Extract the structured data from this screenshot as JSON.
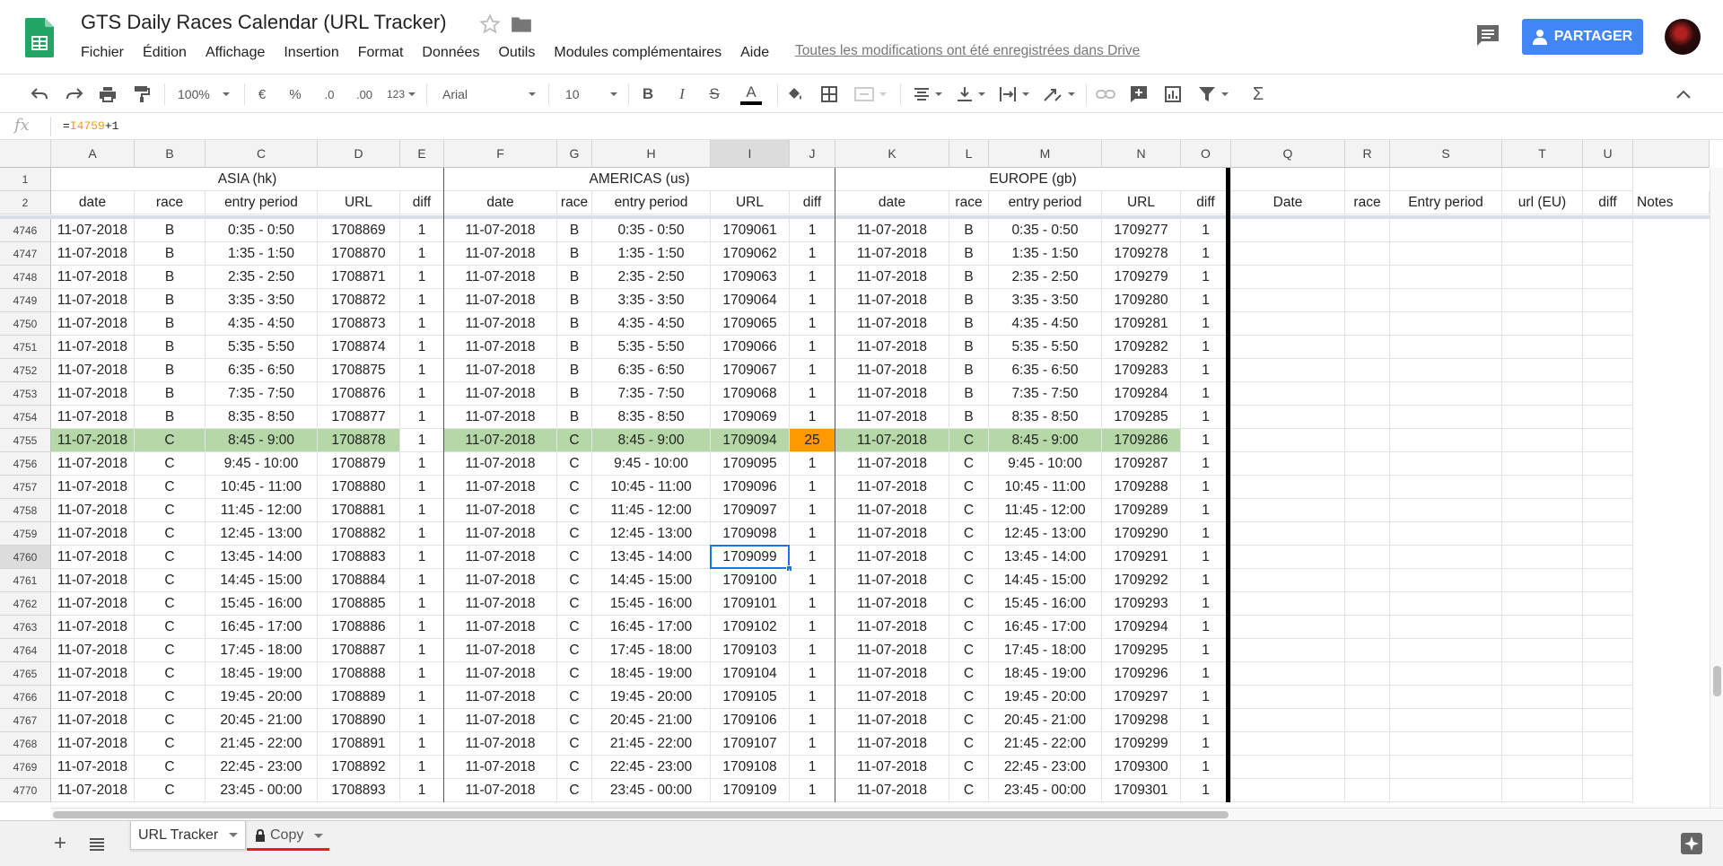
{
  "header": {
    "title": "GTS Daily Races Calendar (URL Tracker)",
    "menu": [
      "Fichier",
      "Édition",
      "Affichage",
      "Insertion",
      "Format",
      "Données",
      "Outils",
      "Modules complémentaires",
      "Aide"
    ],
    "saved_status": "Toutes les modifications ont été enregistrées dans Drive",
    "share_label": "PARTAGER"
  },
  "toolbar": {
    "zoom": "100%",
    "currency": "€",
    "percent": "%",
    "dec_less": ".0",
    "dec_more": ".00",
    "more_formats": "123",
    "font": "Arial",
    "font_size": "10",
    "bold": "B",
    "italic": "I",
    "strike": "S",
    "text_color_label": "A",
    "sum": "Σ"
  },
  "formula_bar": {
    "fx": "fx",
    "prefix": "=",
    "ref": "I4759",
    "suffix": "+1"
  },
  "colors": {
    "green_row": "#b6d7a8",
    "orange_cell": "#ff9900",
    "selection": "#1a73e8",
    "share": "#4285f4"
  },
  "columns": [
    "A",
    "B",
    "C",
    "D",
    "E",
    "F",
    "G",
    "H",
    "I",
    "J",
    "K",
    "L",
    "M",
    "N",
    "O",
    "Q",
    "R",
    "S",
    "T",
    "U"
  ],
  "active_column": "I",
  "active_row": "4760",
  "frozen_rows": {
    "row1_label": "1",
    "row2_label": "2",
    "groups": [
      "ASIA (hk)",
      "AMERICAS (us)",
      "EUROPE (gb)"
    ],
    "headers_main": [
      "date",
      "race",
      "entry period",
      "URL",
      "diff"
    ],
    "headers_extra": [
      "Date",
      "race",
      "Entry period",
      "url (EU)",
      "diff",
      "Notes"
    ]
  },
  "rows": [
    {
      "n": "4746",
      "date": "11-07-2018",
      "race": "B",
      "period": "0:35 - 0:50",
      "url_asia": "1708869",
      "diff_asia": "1",
      "url_am": "1709061",
      "diff_am": "1",
      "url_eu": "1709277",
      "diff_eu": "1"
    },
    {
      "n": "4747",
      "date": "11-07-2018",
      "race": "B",
      "period": "1:35 - 1:50",
      "url_asia": "1708870",
      "diff_asia": "1",
      "url_am": "1709062",
      "diff_am": "1",
      "url_eu": "1709278",
      "diff_eu": "1"
    },
    {
      "n": "4748",
      "date": "11-07-2018",
      "race": "B",
      "period": "2:35 - 2:50",
      "url_asia": "1708871",
      "diff_asia": "1",
      "url_am": "1709063",
      "diff_am": "1",
      "url_eu": "1709279",
      "diff_eu": "1"
    },
    {
      "n": "4749",
      "date": "11-07-2018",
      "race": "B",
      "period": "3:35 - 3:50",
      "url_asia": "1708872",
      "diff_asia": "1",
      "url_am": "1709064",
      "diff_am": "1",
      "url_eu": "1709280",
      "diff_eu": "1"
    },
    {
      "n": "4750",
      "date": "11-07-2018",
      "race": "B",
      "period": "4:35 - 4:50",
      "url_asia": "1708873",
      "diff_asia": "1",
      "url_am": "1709065",
      "diff_am": "1",
      "url_eu": "1709281",
      "diff_eu": "1"
    },
    {
      "n": "4751",
      "date": "11-07-2018",
      "race": "B",
      "period": "5:35 - 5:50",
      "url_asia": "1708874",
      "diff_asia": "1",
      "url_am": "1709066",
      "diff_am": "1",
      "url_eu": "1709282",
      "diff_eu": "1"
    },
    {
      "n": "4752",
      "date": "11-07-2018",
      "race": "B",
      "period": "6:35 - 6:50",
      "url_asia": "1708875",
      "diff_asia": "1",
      "url_am": "1709067",
      "diff_am": "1",
      "url_eu": "1709283",
      "diff_eu": "1"
    },
    {
      "n": "4753",
      "date": "11-07-2018",
      "race": "B",
      "period": "7:35 - 7:50",
      "url_asia": "1708876",
      "diff_asia": "1",
      "url_am": "1709068",
      "diff_am": "1",
      "url_eu": "1709284",
      "diff_eu": "1"
    },
    {
      "n": "4754",
      "date": "11-07-2018",
      "race": "B",
      "period": "8:35 - 8:50",
      "url_asia": "1708877",
      "diff_asia": "1",
      "url_am": "1709069",
      "diff_am": "1",
      "url_eu": "1709285",
      "diff_eu": "1"
    },
    {
      "n": "4755",
      "date": "11-07-2018",
      "race": "C",
      "period": "8:45 - 9:00",
      "url_asia": "1708878",
      "diff_asia": "1",
      "url_am": "1709094",
      "diff_am": "25",
      "url_eu": "1709286",
      "diff_eu": "1",
      "highlight": true
    },
    {
      "n": "4756",
      "date": "11-07-2018",
      "race": "C",
      "period": "9:45 - 10:00",
      "url_asia": "1708879",
      "diff_asia": "1",
      "url_am": "1709095",
      "diff_am": "1",
      "url_eu": "1709287",
      "diff_eu": "1"
    },
    {
      "n": "4757",
      "date": "11-07-2018",
      "race": "C",
      "period": "10:45 - 11:00",
      "url_asia": "1708880",
      "diff_asia": "1",
      "url_am": "1709096",
      "diff_am": "1",
      "url_eu": "1709288",
      "diff_eu": "1"
    },
    {
      "n": "4758",
      "date": "11-07-2018",
      "race": "C",
      "period": "11:45 - 12:00",
      "url_asia": "1708881",
      "diff_asia": "1",
      "url_am": "1709097",
      "diff_am": "1",
      "url_eu": "1709289",
      "diff_eu": "1"
    },
    {
      "n": "4759",
      "date": "11-07-2018",
      "race": "C",
      "period": "12:45 - 13:00",
      "url_asia": "1708882",
      "diff_asia": "1",
      "url_am": "1709098",
      "diff_am": "1",
      "url_eu": "1709290",
      "diff_eu": "1"
    },
    {
      "n": "4760",
      "date": "11-07-2018",
      "race": "C",
      "period": "13:45 - 14:00",
      "url_asia": "1708883",
      "diff_asia": "1",
      "url_am": "1709099",
      "diff_am": "1",
      "url_eu": "1709291",
      "diff_eu": "1"
    },
    {
      "n": "4761",
      "date": "11-07-2018",
      "race": "C",
      "period": "14:45 - 15:00",
      "url_asia": "1708884",
      "diff_asia": "1",
      "url_am": "1709100",
      "diff_am": "1",
      "url_eu": "1709292",
      "diff_eu": "1"
    },
    {
      "n": "4762",
      "date": "11-07-2018",
      "race": "C",
      "period": "15:45 - 16:00",
      "url_asia": "1708885",
      "diff_asia": "1",
      "url_am": "1709101",
      "diff_am": "1",
      "url_eu": "1709293",
      "diff_eu": "1"
    },
    {
      "n": "4763",
      "date": "11-07-2018",
      "race": "C",
      "period": "16:45 - 17:00",
      "url_asia": "1708886",
      "diff_asia": "1",
      "url_am": "1709102",
      "diff_am": "1",
      "url_eu": "1709294",
      "diff_eu": "1"
    },
    {
      "n": "4764",
      "date": "11-07-2018",
      "race": "C",
      "period": "17:45 - 18:00",
      "url_asia": "1708887",
      "diff_asia": "1",
      "url_am": "1709103",
      "diff_am": "1",
      "url_eu": "1709295",
      "diff_eu": "1"
    },
    {
      "n": "4765",
      "date": "11-07-2018",
      "race": "C",
      "period": "18:45 - 19:00",
      "url_asia": "1708888",
      "diff_asia": "1",
      "url_am": "1709104",
      "diff_am": "1",
      "url_eu": "1709296",
      "diff_eu": "1"
    },
    {
      "n": "4766",
      "date": "11-07-2018",
      "race": "C",
      "period": "19:45 - 20:00",
      "url_asia": "1708889",
      "diff_asia": "1",
      "url_am": "1709105",
      "diff_am": "1",
      "url_eu": "1709297",
      "diff_eu": "1"
    },
    {
      "n": "4767",
      "date": "11-07-2018",
      "race": "C",
      "period": "20:45 - 21:00",
      "url_asia": "1708890",
      "diff_asia": "1",
      "url_am": "1709106",
      "diff_am": "1",
      "url_eu": "1709298",
      "diff_eu": "1"
    },
    {
      "n": "4768",
      "date": "11-07-2018",
      "race": "C",
      "period": "21:45 - 22:00",
      "url_asia": "1708891",
      "diff_asia": "1",
      "url_am": "1709107",
      "diff_am": "1",
      "url_eu": "1709299",
      "diff_eu": "1"
    },
    {
      "n": "4769",
      "date": "11-07-2018",
      "race": "C",
      "period": "22:45 - 23:00",
      "url_asia": "1708892",
      "diff_asia": "1",
      "url_am": "1709108",
      "diff_am": "1",
      "url_eu": "1709300",
      "diff_eu": "1"
    },
    {
      "n": "4770",
      "date": "11-07-2018",
      "race": "C",
      "period": "23:45 - 00:00",
      "url_asia": "1708893",
      "diff_asia": "1",
      "url_am": "1709109",
      "diff_am": "1",
      "url_eu": "1709301",
      "diff_eu": "1"
    }
  ],
  "sheets": [
    {
      "label": "URL Tracker",
      "active": true,
      "locked": false
    },
    {
      "label": "Copy",
      "active": false,
      "locked": true
    }
  ]
}
